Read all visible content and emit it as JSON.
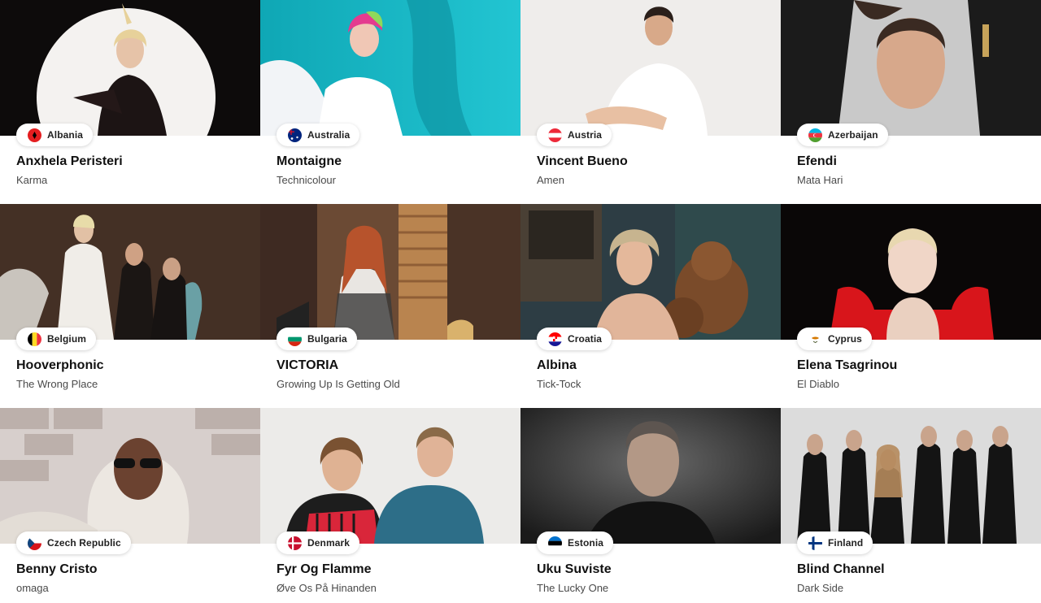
{
  "entries": [
    {
      "country": "Albania",
      "artist": "Anxhela Peristeri",
      "song": "Karma",
      "flag_icon": "albania-flag-icon"
    },
    {
      "country": "Australia",
      "artist": "Montaigne",
      "song": "Technicolour",
      "flag_icon": "australia-flag-icon"
    },
    {
      "country": "Austria",
      "artist": "Vincent Bueno",
      "song": "Amen",
      "flag_icon": "austria-flag-icon"
    },
    {
      "country": "Azerbaijan",
      "artist": "Efendi",
      "song": "Mata Hari",
      "flag_icon": "azerbaijan-flag-icon"
    },
    {
      "country": "Belgium",
      "artist": "Hooverphonic",
      "song": "The Wrong Place",
      "flag_icon": "belgium-flag-icon"
    },
    {
      "country": "Bulgaria",
      "artist": "VICTORIA",
      "song": "Growing Up Is Getting Old",
      "flag_icon": "bulgaria-flag-icon"
    },
    {
      "country": "Croatia",
      "artist": "Albina",
      "song": "Tick-Tock",
      "flag_icon": "croatia-flag-icon"
    },
    {
      "country": "Cyprus",
      "artist": "Elena Tsagrinou",
      "song": "El Diablo",
      "flag_icon": "cyprus-flag-icon"
    },
    {
      "country": "Czech Republic",
      "artist": "Benny Cristo",
      "song": "omaga",
      "flag_icon": "czech-republic-flag-icon"
    },
    {
      "country": "Denmark",
      "artist": "Fyr Og Flamme",
      "song": "Øve Os På Hinanden",
      "flag_icon": "denmark-flag-icon"
    },
    {
      "country": "Estonia",
      "artist": "Uku Suviste",
      "song": "The Lucky One",
      "flag_icon": "estonia-flag-icon"
    },
    {
      "country": "Finland",
      "artist": "Blind Channel",
      "song": "Dark Side",
      "flag_icon": "finland-flag-icon"
    }
  ]
}
